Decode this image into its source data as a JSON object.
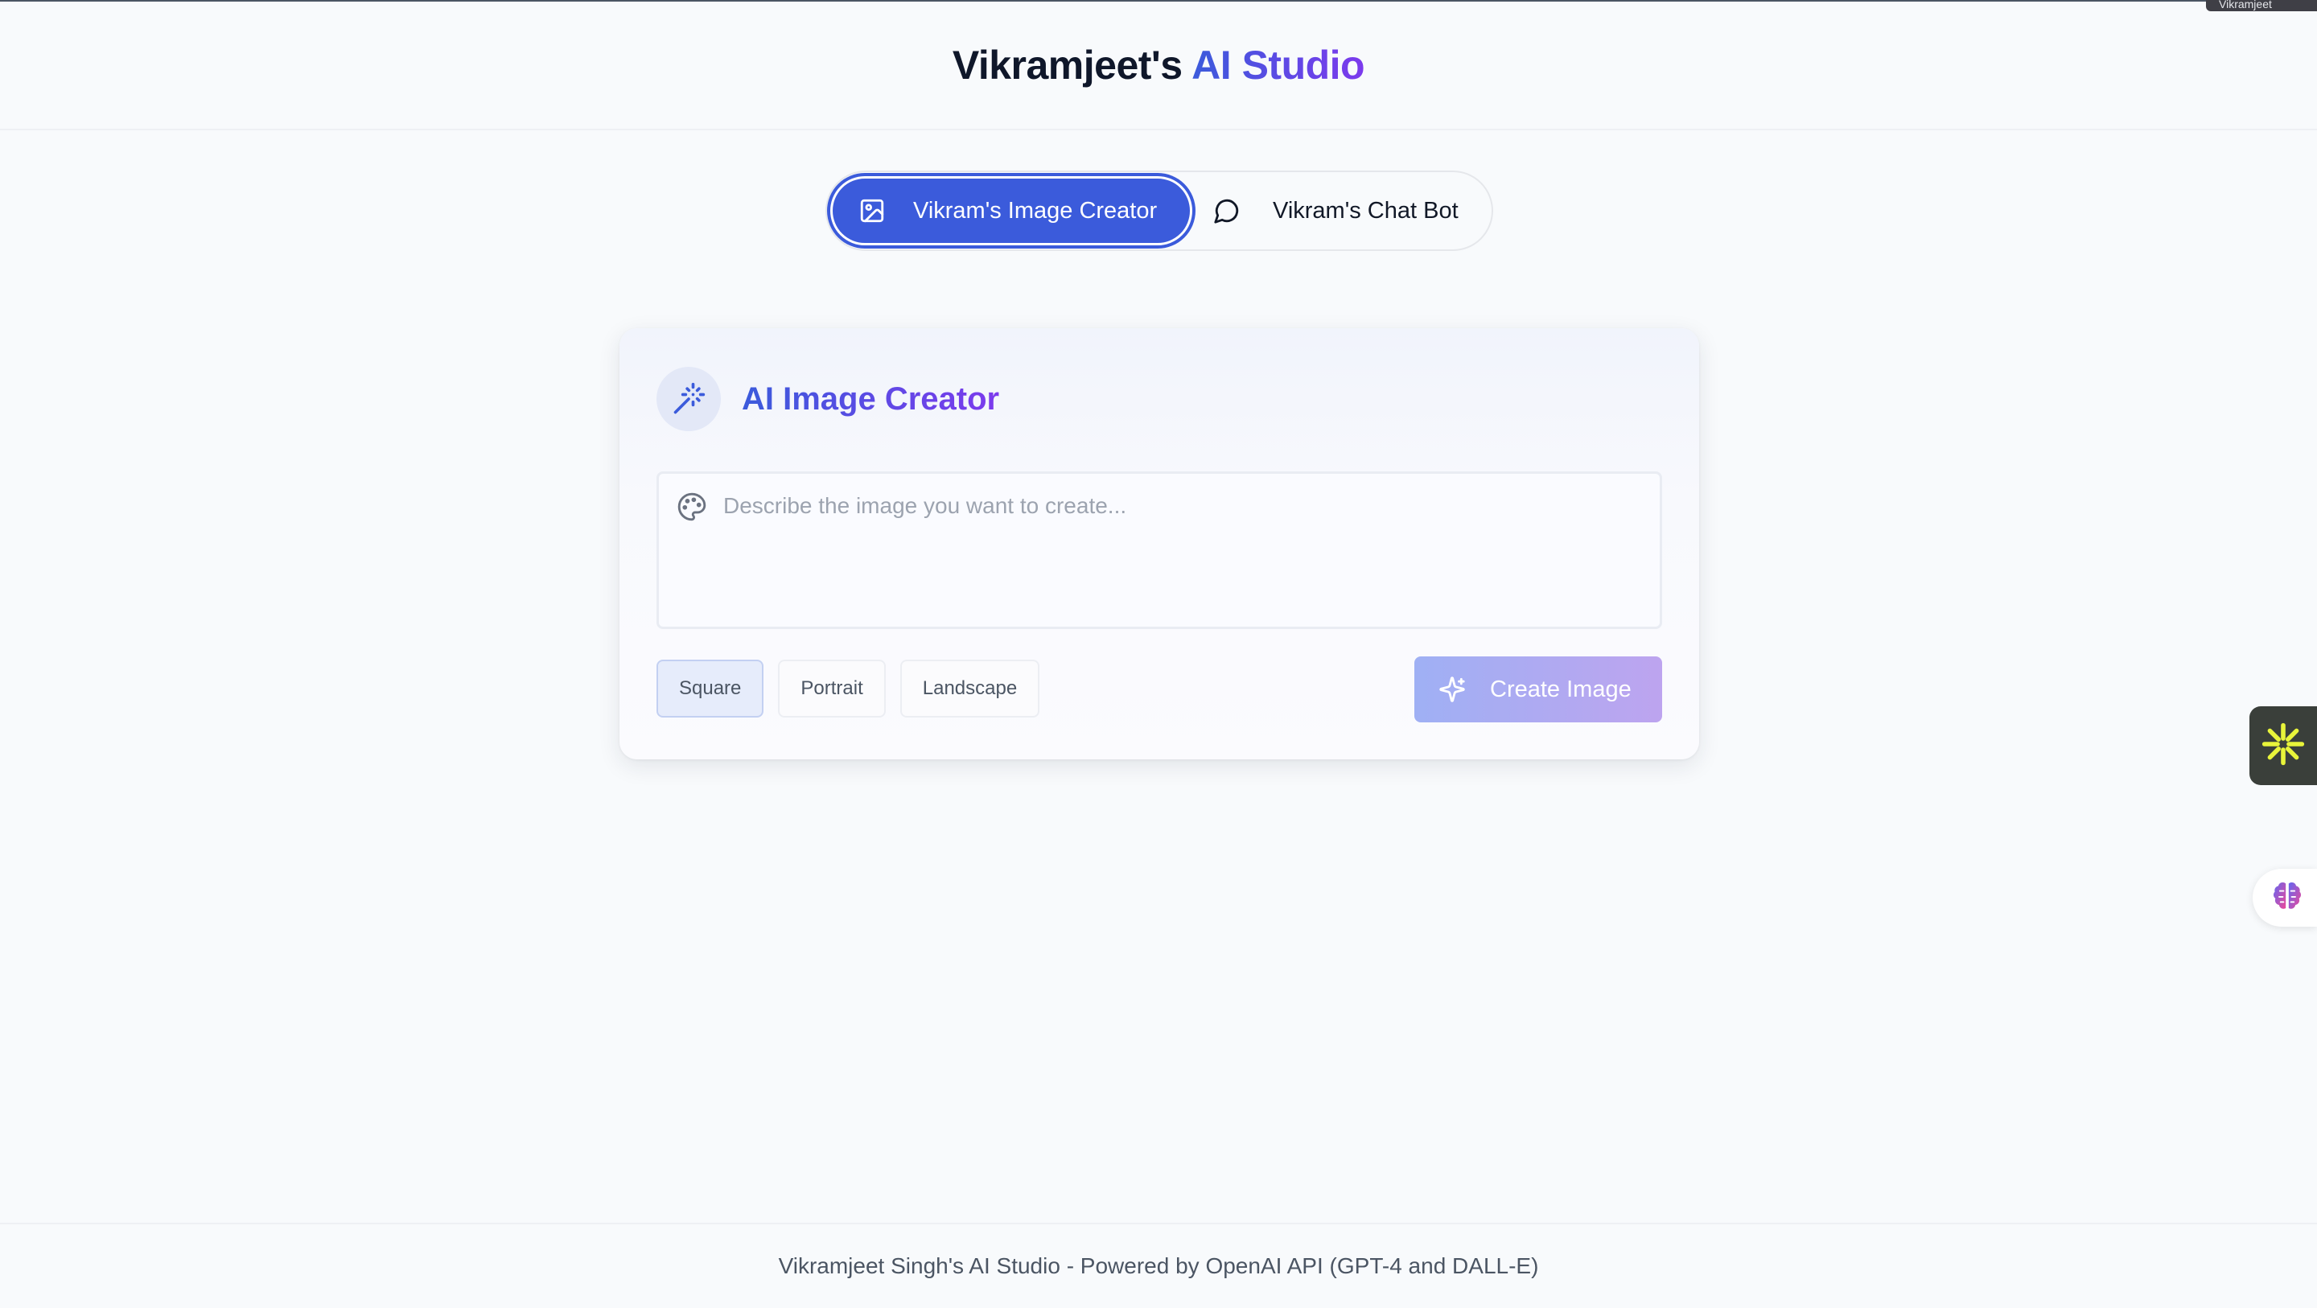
{
  "header": {
    "title_plain": "Vikramjeet's",
    "title_accent": "AI Studio"
  },
  "corner_tab": {
    "label": "Vikramjeet"
  },
  "tabs": [
    {
      "label": "Vikram's Image Creator",
      "icon": "image-icon",
      "active": true
    },
    {
      "label": "Vikram's Chat Bot",
      "icon": "chat-bubble-icon",
      "active": false
    }
  ],
  "creator": {
    "title": "AI Image Creator",
    "title_icon": "magic-wand-icon",
    "prompt": {
      "value": "",
      "placeholder": "Describe the image you want to create...",
      "icon": "palette-icon"
    },
    "aspect_options": [
      {
        "label": "Square",
        "selected": true
      },
      {
        "label": "Portrait",
        "selected": false
      },
      {
        "label": "Landscape",
        "selected": false
      }
    ],
    "create_button": {
      "label": "Create Image",
      "icon": "sparkles-icon"
    }
  },
  "side_widgets": {
    "widget_one_icon": "asterisk-burst-icon",
    "widget_two_icon": "brain-icon"
  },
  "footer": {
    "text": "Vikramjeet Singh's AI Studio - Powered by OpenAI API (GPT-4 and DALL-E)"
  },
  "colors": {
    "accent": "#3b5bdb",
    "accent_gradient_end": "#7c3aed",
    "background": "#f8fafc",
    "muted_text": "#4b5563",
    "placeholder_text": "#9ca3af"
  }
}
